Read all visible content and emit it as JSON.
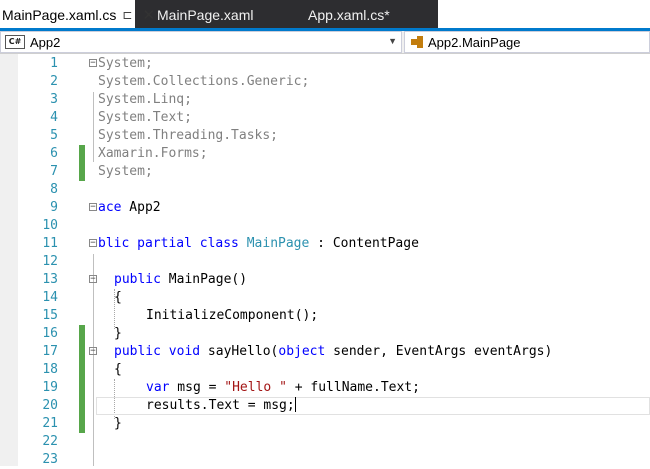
{
  "tabs": [
    {
      "label": "MainPage.xaml.cs",
      "pin": "⊏",
      "close": "✕"
    },
    {
      "label": "MainPage.xaml"
    },
    {
      "label": "App.xaml.cs*"
    }
  ],
  "navbar": {
    "project_badge": "C#",
    "project": "App2",
    "member": "App2.MainPage"
  },
  "lines": [
    {
      "n": "1",
      "tokens": [
        {
          "t": "System;",
          "c": "gr"
        }
      ]
    },
    {
      "n": "2",
      "tokens": [
        {
          "t": "System.Collections.Generic;",
          "c": "gr"
        }
      ]
    },
    {
      "n": "3",
      "tokens": [
        {
          "t": "System.Linq;",
          "c": "gr"
        }
      ]
    },
    {
      "n": "4",
      "tokens": [
        {
          "t": "System.Text;",
          "c": "gr"
        }
      ]
    },
    {
      "n": "5",
      "tokens": [
        {
          "t": "System.Threading.Tasks;",
          "c": "gr"
        }
      ]
    },
    {
      "n": "6",
      "tokens": [
        {
          "t": "Xamarin.Forms;",
          "c": "gr"
        }
      ]
    },
    {
      "n": "7",
      "tokens": [
        {
          "t": "System;",
          "c": "gr"
        }
      ]
    },
    {
      "n": "8",
      "tokens": []
    },
    {
      "n": "9",
      "tokens": [
        {
          "t": "ace",
          "c": "kw"
        },
        {
          "t": " App2",
          "c": ""
        }
      ]
    },
    {
      "n": "10",
      "tokens": []
    },
    {
      "n": "11",
      "tokens": [
        {
          "t": "blic partial class ",
          "c": "kw"
        },
        {
          "t": "MainPage",
          "c": "ty"
        },
        {
          "t": " : ContentPage",
          "c": ""
        }
      ]
    },
    {
      "n": "12",
      "tokens": []
    },
    {
      "n": "13",
      "tokens": [
        {
          "t": "public ",
          "c": "kw"
        },
        {
          "t": "MainPage()",
          "c": ""
        }
      ]
    },
    {
      "n": "14",
      "tokens": [
        {
          "t": "{",
          "c": ""
        }
      ]
    },
    {
      "n": "15",
      "tokens": [
        {
          "t": "InitializeComponent();",
          "c": ""
        }
      ]
    },
    {
      "n": "16",
      "tokens": [
        {
          "t": "}",
          "c": ""
        }
      ]
    },
    {
      "n": "17",
      "tokens": [
        {
          "t": "public void ",
          "c": "kw"
        },
        {
          "t": "sayHello(",
          "c": ""
        },
        {
          "t": "object",
          "c": "kw"
        },
        {
          "t": " sender, EventArgs eventArgs)",
          "c": ""
        }
      ]
    },
    {
      "n": "18",
      "tokens": [
        {
          "t": "{",
          "c": ""
        }
      ]
    },
    {
      "n": "19",
      "tokens": [
        {
          "t": "var",
          "c": "kw"
        },
        {
          "t": " msg = ",
          "c": ""
        },
        {
          "t": "\"Hello \"",
          "c": "st"
        },
        {
          "t": " + fullName.Text;",
          "c": ""
        }
      ]
    },
    {
      "n": "20",
      "tokens": [
        {
          "t": "results.Text = msg;",
          "c": ""
        }
      ]
    },
    {
      "n": "21",
      "tokens": [
        {
          "t": "}",
          "c": ""
        }
      ]
    },
    {
      "n": "22",
      "tokens": []
    },
    {
      "n": "23",
      "tokens": []
    }
  ],
  "colors": {
    "keyword": "#0000ff",
    "type": "#2b91af",
    "string": "#a31515",
    "using": "#808080",
    "change_marker": "#57a64a",
    "tab_accent": "#007acc"
  }
}
